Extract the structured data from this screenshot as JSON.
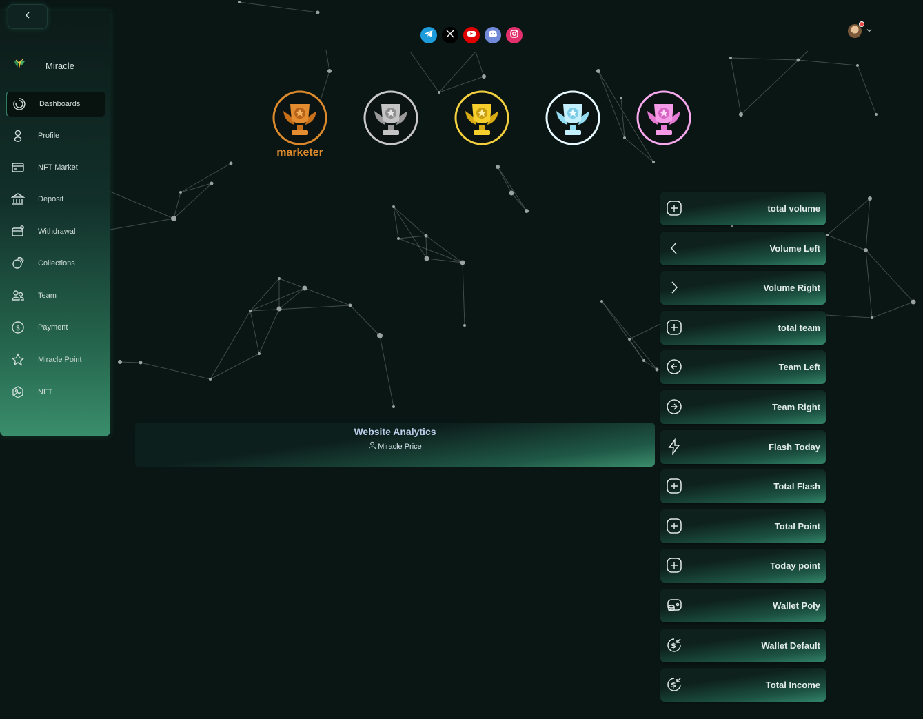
{
  "sidebar": {
    "brand_name": "Miracle",
    "items": [
      {
        "label": "Dashboards",
        "icon": "loading-circle-icon",
        "active": true
      },
      {
        "label": "Profile",
        "icon": "person-icon"
      },
      {
        "label": "NFT Market",
        "icon": "card-icon"
      },
      {
        "label": "Deposit",
        "icon": "bank-icon"
      },
      {
        "label": "Withdrawal",
        "icon": "wallet-card-icon"
      },
      {
        "label": "Collections",
        "icon": "stack-icon"
      },
      {
        "label": "Team",
        "icon": "people-icon"
      },
      {
        "label": "Payment",
        "icon": "dollar-circle-icon"
      },
      {
        "label": "Miracle Point",
        "icon": "star-icon"
      },
      {
        "label": "NFT",
        "icon": "hexagon-image-icon"
      }
    ]
  },
  "header": {
    "socials": [
      {
        "name": "telegram-icon",
        "color": "#1e9bdb"
      },
      {
        "name": "x-icon",
        "color": "#000000"
      },
      {
        "name": "youtube-icon",
        "color": "#e00000"
      },
      {
        "name": "discord-icon",
        "color": "#7289da"
      },
      {
        "name": "instagram-icon",
        "color": "#e1306c"
      }
    ]
  },
  "ranks": {
    "current_label": "marketer",
    "medals": [
      {
        "name": "bronze-trophy-icon",
        "color": "#dd8a2d"
      },
      {
        "name": "silver-trophy-icon",
        "color": "#c8c8c8"
      },
      {
        "name": "gold-trophy-icon",
        "color": "#f4d03f"
      },
      {
        "name": "diamond-trophy-icon",
        "color": "#bfeefc"
      },
      {
        "name": "pink-trophy-icon",
        "color": "#f38ee4"
      }
    ]
  },
  "analytics": {
    "title": "Website Analytics",
    "subtitle": "Miracle Price"
  },
  "stats": [
    {
      "label": "total volume",
      "icon": "plus-square-icon"
    },
    {
      "label": "Volume Left",
      "icon": "chevron-left-icon"
    },
    {
      "label": "Volume Right",
      "icon": "chevron-right-icon"
    },
    {
      "label": "total team",
      "icon": "plus-square-icon"
    },
    {
      "label": "Team Left",
      "icon": "arrow-left-circle-icon"
    },
    {
      "label": "Team Right",
      "icon": "arrow-right-circle-icon"
    },
    {
      "label": "Flash Today",
      "icon": "lightning-icon"
    },
    {
      "label": "Total Flash",
      "icon": "plus-square-icon"
    },
    {
      "label": "Total Point",
      "icon": "plus-square-icon"
    },
    {
      "label": "Today point",
      "icon": "plus-square-icon"
    },
    {
      "label": "Wallet Poly",
      "icon": "coins-wallet-icon"
    },
    {
      "label": "Wallet Default",
      "icon": "dollar-refresh-icon"
    },
    {
      "label": "Total Income",
      "icon": "dollar-refresh-icon"
    }
  ],
  "colors": {
    "background": "#0a1614",
    "accent": "#3a8e6c",
    "rank_label": "#dd8a2d"
  }
}
